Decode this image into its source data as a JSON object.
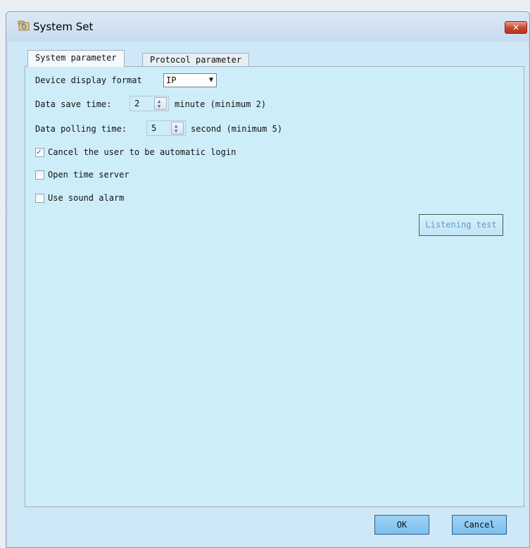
{
  "window": {
    "title": "System Set",
    "close_icon": "✕"
  },
  "tabs": [
    {
      "label": "System parameter",
      "active": true
    },
    {
      "label": "Protocol parameter",
      "active": false
    }
  ],
  "system": {
    "device_display_label": "Device display format",
    "device_display_value": "IP",
    "data_save_label": "Data save time:",
    "data_save_value": "2",
    "data_save_unit": "minute (minimum 2)",
    "polling_label": "Data polling time:",
    "polling_value": "5",
    "polling_unit": "second (minimum 5)",
    "cancel_auto_login_label": "Cancel the user to be automatic login",
    "cancel_auto_login_checked": true,
    "open_time_server_label": "Open time server",
    "open_time_server_checked": false,
    "sound_alarm_label": "Use sound alarm",
    "sound_alarm_checked": false,
    "listening_test_label": "Listening test"
  },
  "footer": {
    "ok_label": "OK",
    "cancel_label": "Cancel"
  },
  "colors": {
    "accent": "#7cc0ef",
    "panel_bg": "#cdeef9",
    "close_red": "#c8442a"
  }
}
